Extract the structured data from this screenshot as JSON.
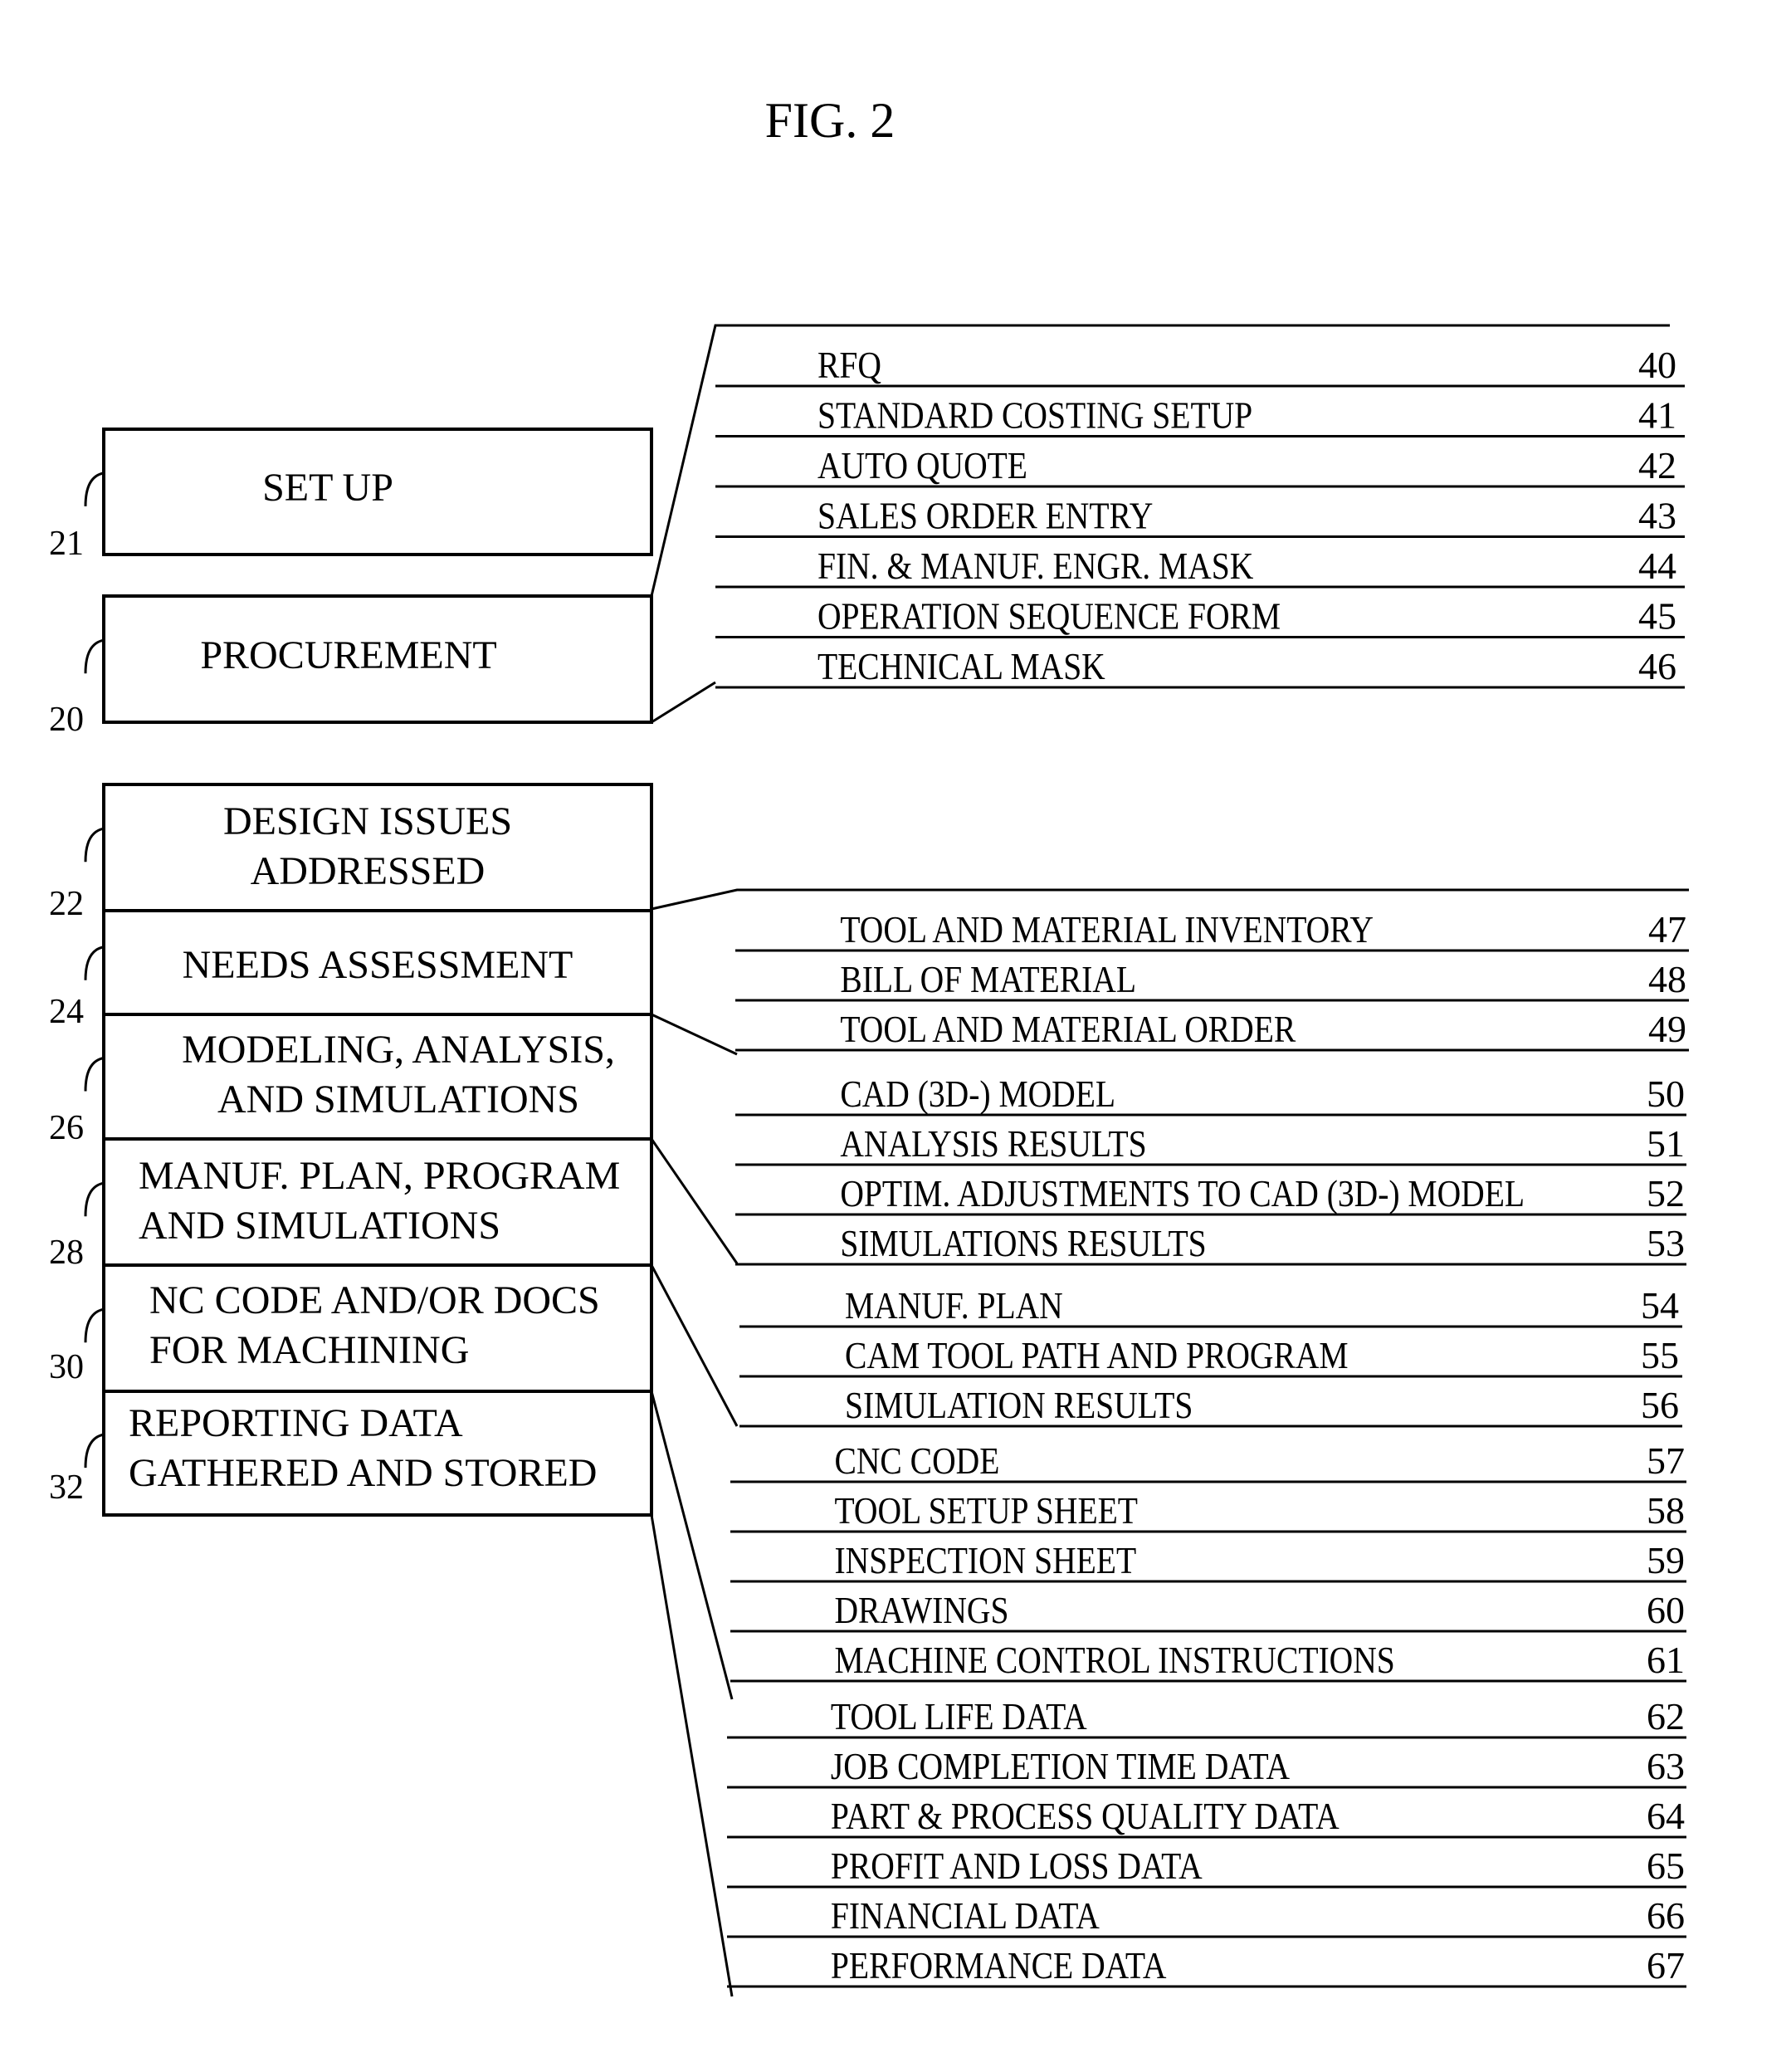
{
  "figure": {
    "title": "FIG. 2"
  },
  "boxes": [
    {
      "ref": "21",
      "lines": [
        "SET UP"
      ]
    },
    {
      "ref": "20",
      "lines": [
        "PROCUREMENT"
      ]
    },
    {
      "ref": "22",
      "lines": [
        "DESIGN ISSUES",
        "ADDRESSED"
      ]
    },
    {
      "ref": "24",
      "lines": [
        "NEEDS ASSESSMENT"
      ]
    },
    {
      "ref": "26",
      "lines": [
        "MODELING, ANALYSIS,",
        "AND SIMULATIONS"
      ]
    },
    {
      "ref": "28",
      "lines": [
        "MANUF. PLAN, PROGRAM",
        "AND SIMULATIONS"
      ]
    },
    {
      "ref": "30",
      "lines": [
        "NC CODE AND/OR  DOCS",
        "FOR MACHINING"
      ]
    },
    {
      "ref": "32",
      "lines": [
        "REPORTING DATA",
        "GATHERED AND STORED"
      ]
    }
  ],
  "item_groups": [
    {
      "source_ref": "20",
      "items": [
        {
          "label": "RFQ",
          "ref": "40"
        },
        {
          "label": "STANDARD COSTING SETUP",
          "ref": "41"
        },
        {
          "label": "AUTO QUOTE",
          "ref": "42"
        },
        {
          "label": "SALES ORDER ENTRY",
          "ref": "43"
        },
        {
          "label": "FIN. & MANUF. ENGR. MASK",
          "ref": "44"
        },
        {
          "label": "OPERATION SEQUENCE FORM",
          "ref": "45"
        },
        {
          "label": "TECHNICAL MASK",
          "ref": "46"
        }
      ]
    },
    {
      "source_ref": "24",
      "items": [
        {
          "label": "TOOL AND MATERIAL INVENTORY",
          "ref": "47"
        },
        {
          "label": "BILL OF MATERIAL",
          "ref": "48"
        },
        {
          "label": "TOOL AND MATERIAL ORDER",
          "ref": "49"
        }
      ]
    },
    {
      "source_ref": "26",
      "items": [
        {
          "label": "CAD (3D-) MODEL",
          "ref": "50"
        },
        {
          "label": "ANALYSIS RESULTS",
          "ref": "51"
        },
        {
          "label": "OPTIM. ADJUSTMENTS TO CAD (3D-) MODEL",
          "ref": "52"
        },
        {
          "label": "SIMULATIONS RESULTS",
          "ref": "53"
        }
      ]
    },
    {
      "source_ref": "28",
      "items": [
        {
          "label": "MANUF. PLAN",
          "ref": "54"
        },
        {
          "label": "CAM TOOL PATH AND PROGRAM",
          "ref": "55"
        },
        {
          "label": "SIMULATION RESULTS",
          "ref": "56"
        }
      ]
    },
    {
      "source_ref": "30",
      "items": [
        {
          "label": "CNC CODE",
          "ref": "57"
        },
        {
          "label": "TOOL SETUP SHEET",
          "ref": "58"
        },
        {
          "label": "INSPECTION SHEET",
          "ref": "59"
        },
        {
          "label": "DRAWINGS",
          "ref": "60"
        },
        {
          "label": "MACHINE CONTROL INSTRUCTIONS",
          "ref": "61"
        }
      ]
    },
    {
      "source_ref": "32",
      "items": [
        {
          "label": "TOOL LIFE DATA",
          "ref": "62"
        },
        {
          "label": "JOB COMPLETION TIME DATA",
          "ref": "63"
        },
        {
          "label": "PART & PROCESS QUALITY DATA",
          "ref": "64"
        },
        {
          "label": "PROFIT AND LOSS DATA",
          "ref": "65"
        },
        {
          "label": "FINANCIAL DATA",
          "ref": "66"
        },
        {
          "label": "PERFORMANCE DATA",
          "ref": "67"
        }
      ]
    }
  ]
}
